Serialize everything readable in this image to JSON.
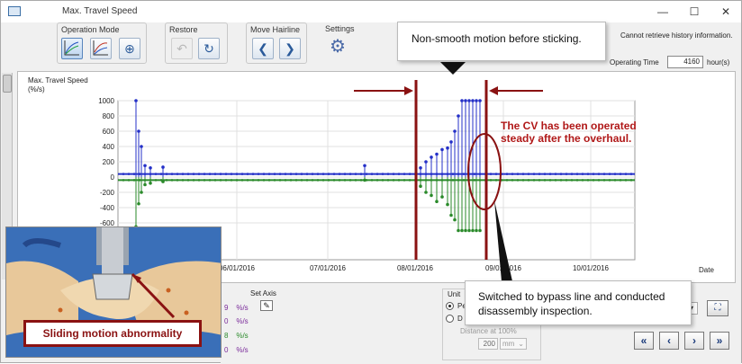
{
  "window": {
    "title": "Max. Travel Speed",
    "minimize": "—",
    "maximize": "☐",
    "close": "✕"
  },
  "toolbar": {
    "operation_mode_label": "Operation Mode",
    "restore_label": "Restore",
    "move_hairline_label": "Move Hairline",
    "settings_label": "Settings"
  },
  "status": {
    "history_message": "Cannot retrieve history information.",
    "operating_time_label": "Operating Time",
    "operating_time_value": "4160",
    "operating_time_unit": "hour(s)"
  },
  "chart_data": {
    "type": "line",
    "ylabel_line1": "Max. Travel Speed",
    "ylabel_line2": "(%/s)",
    "ylim": [
      -700,
      1000
    ],
    "yticks": [
      "1000",
      "800",
      "600",
      "400",
      "200",
      "0",
      "-200",
      "-400",
      "-600"
    ],
    "xlabel": "Date",
    "xticks": [
      "06/01/2016",
      "07/01/2016",
      "08/01/2016",
      "09/01/2016",
      "10/01/2016"
    ],
    "grid": true,
    "series": [
      {
        "color": "#2430c8",
        "baseline": 40
      },
      {
        "color": "#2a8a2a",
        "baseline": -40
      }
    ]
  },
  "bottom": {
    "set_axis_label": "Set Axis",
    "unit_rows": [
      {
        "value": "9",
        "unit": "%/s"
      },
      {
        "value": "0",
        "unit": "%/s"
      },
      {
        "value": "8",
        "unit": "%/s"
      },
      {
        "value": "0",
        "unit": "%/s"
      }
    ],
    "unit_group_label": "Unit",
    "radio1_label": "Pe",
    "radio2_label": "D",
    "distance_label": "Distance at 100%",
    "distance_value": "200",
    "distance_unit": "mm"
  },
  "annotations": {
    "top_callout": "Non-smooth motion before sticking.",
    "bottom_callout_line1": "Switched to bypass line and conducted",
    "bottom_callout_line2": "disassembly inspection.",
    "red_note_line1": "The CV has been operated",
    "red_note_line2": "steady after the overhaul.",
    "inset_label": "Sliding motion abnormality"
  }
}
